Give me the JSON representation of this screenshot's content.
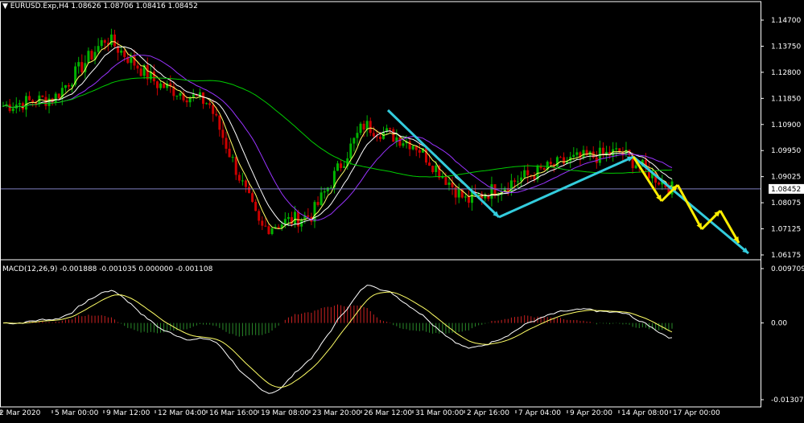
{
  "title": {
    "symbol": "EURUSD.Exp,H4",
    "ohlc": "1.08626 1.08706 1.08416 1.08452",
    "menu_glyph": "▼"
  },
  "macd_title": "MACD(12,26,9) -0.001888 -0.001035 0.000000 -0.001108",
  "price_axis": [
    "1.14700",
    "1.13750",
    "1.12800",
    "1.11850",
    "1.10900",
    "1.09950",
    "1.09025",
    "1.08075",
    "1.07125",
    "1.06175"
  ],
  "current_price": "1.08452",
  "macd_axis": [
    "0.009709",
    "0.00",
    "-0.013074"
  ],
  "time_axis": [
    "2 Mar 2020",
    "5 Mar 00:00",
    "9 Mar 12:00",
    "12 Mar 04:00",
    "16 Mar 16:00",
    "19 Mar 08:00",
    "23 Mar 20:00",
    "26 Mar 12:00",
    "31 Mar 00:00",
    "2 Apr 16:00",
    "7 Apr 04:00",
    "9 Apr 20:00",
    "14 Apr 08:00",
    "17 Apr 00:00"
  ],
  "colors": {
    "background": "#000000",
    "grid_border": "#ffffff",
    "bull": "#00b300",
    "bear": "#cc0000",
    "ma_fast": "#ffff66",
    "ma_white": "#ffffff",
    "ma_purple": "#9933ff",
    "ma_green": "#00cc00",
    "hline": "#8080c0",
    "arrow_cyan": "#33ccdd",
    "arrow_yellow": "#ffee00",
    "macd_pos": "#cc2222",
    "macd_neg": "#2a8a2a",
    "signal": "#ffff66"
  },
  "chart_data": {
    "type": "line",
    "series": [
      {
        "x": [
          "2 Mar 2020",
          "5 Mar 00:00",
          "9 Mar 12:00",
          "12 Mar 04:00",
          "16 Mar 16:00",
          "19 Mar 08:00",
          "23 Mar 20:00",
          "26 Mar 12:00",
          "31 Mar 00:00",
          "2 Apr 16:00",
          "7 Apr 04:00",
          "9 Apr 20:00",
          "14 Apr 08:00",
          "17 Apr 00:00"
        ],
        "values": [
          1.115,
          1.118,
          1.14,
          1.123,
          1.116,
          1.07,
          1.075,
          1.108,
          1.101,
          1.08,
          1.088,
          1.095,
          1.098,
          1.0845
        ]
      }
    ],
    "ylim": [
      1.06,
      1.15
    ],
    "macd_ylim": [
      -0.013074,
      0.009709
    ],
    "grid": false
  }
}
